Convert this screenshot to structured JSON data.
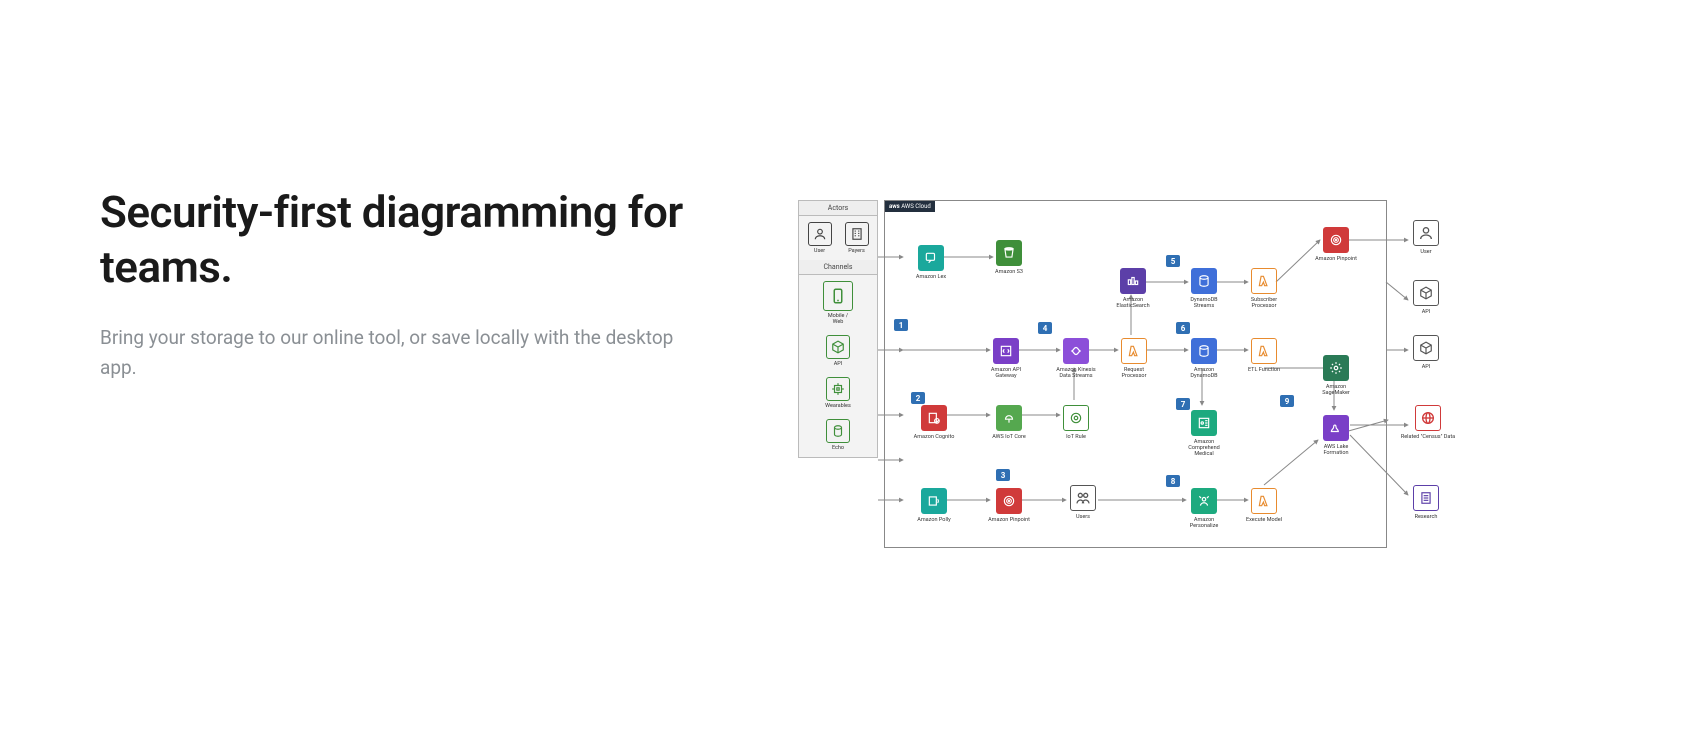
{
  "hero": {
    "title": "Security-first diagramming for teams.",
    "subtitle": "Bring your storage to our online tool, or save locally with the desktop app."
  },
  "diagram": {
    "cloud_label": "AWS Cloud",
    "sidebar": {
      "actors_header": "Actors",
      "actors": [
        {
          "label": "User"
        },
        {
          "label": "Payers"
        }
      ],
      "channels_header": "Channels",
      "channels": [
        {
          "label": "Mobile / Web"
        },
        {
          "label": "API"
        },
        {
          "label": "Wearables"
        },
        {
          "label": "Echo"
        }
      ]
    },
    "badges": [
      "1",
      "2",
      "3",
      "4",
      "5",
      "6",
      "7",
      "8",
      "9"
    ],
    "nodes": {
      "lex": "Amazon Lex",
      "s3": "Amazon S3",
      "elastic": "Amazon ElasticSearch",
      "ddb_streams": "DynamoDB Streams",
      "sub_proc": "Subscriber Processor",
      "api_gw": "Amazon API Gateway",
      "kinesis": "Amazon Kinesis Data Streams",
      "req_proc": "Request Processor",
      "ddb": "Amazon DynamoDB",
      "etl": "ETL Function",
      "cognito": "Amazon Cognito",
      "iot_core": "AWS IoT Core",
      "iot_rule": "IoT Rule",
      "comprehend": "Amazon Comprehend Medical",
      "sagemaker": "Amazon SageMaker",
      "polly": "Amazon Polly",
      "pinpoint2": "Amazon Pinpoint",
      "users": "Users",
      "personalize": "Amazon Personalize",
      "exec_model": "Execute Model",
      "lakef": "AWS Lake Formation",
      "pinpoint": "Amazon Pinpoint",
      "user_out": "User",
      "api_out": "API",
      "api_out2": "API",
      "census": "Related \"Census\" Data",
      "research": "Research"
    }
  }
}
